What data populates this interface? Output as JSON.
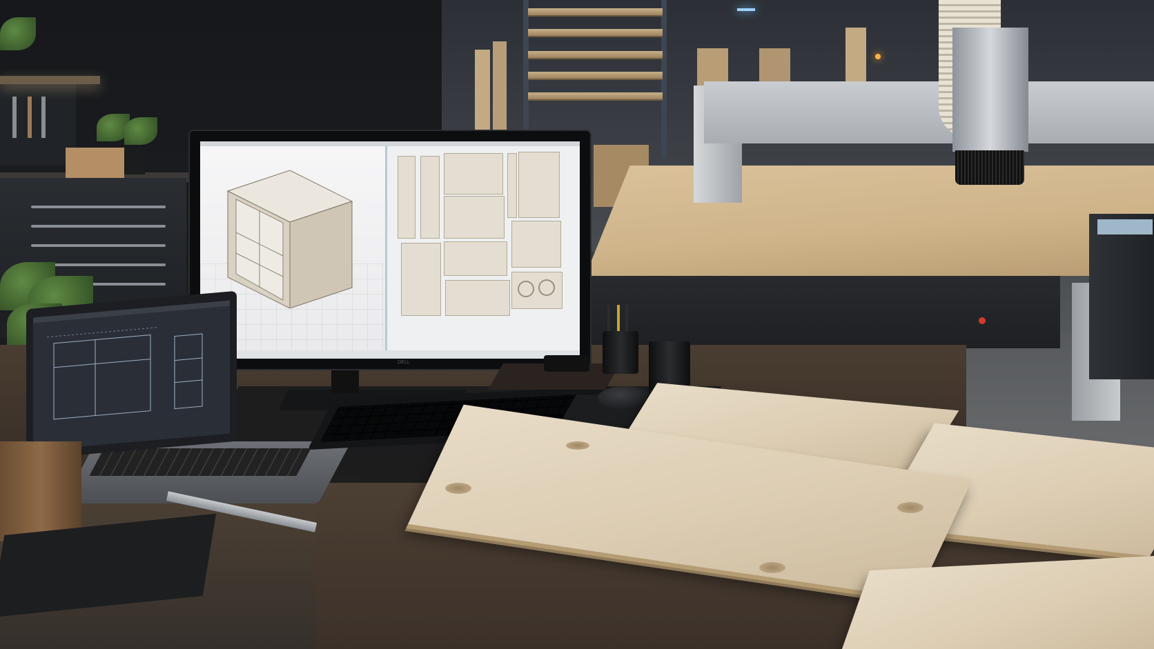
{
  "scene": {
    "description_colors": {
      "wall": "#16181b",
      "plywood": "#e0d2b9",
      "desk_wood": "#4a3d31",
      "cnc_bed": "#d2b88e",
      "monitor_screen": "#f2f3f5",
      "laptop_screen": "#2a2f37"
    },
    "monitor": {
      "brand_mark": "DELL"
    }
  }
}
